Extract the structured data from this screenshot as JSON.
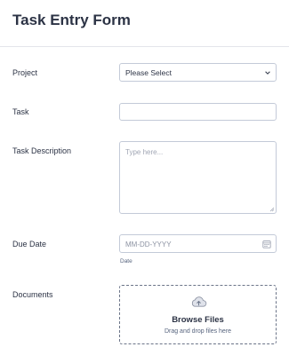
{
  "form": {
    "title": "Task Entry Form"
  },
  "fields": {
    "project": {
      "label": "Project",
      "selected": "Please Select"
    },
    "task": {
      "label": "Task",
      "value": ""
    },
    "description": {
      "label": "Task Description",
      "placeholder": "Type here..."
    },
    "due_date": {
      "label": "Due Date",
      "placeholder": "MM-DD-YYYY",
      "sublabel": "Date"
    },
    "documents": {
      "label": "Documents",
      "button_text": "Browse Files",
      "hint": "Drag and drop files here"
    }
  },
  "icons": {
    "select_chevron": "chevron-down-icon",
    "calendar": "calendar-icon",
    "upload": "cloud-upload-icon",
    "resize": "resize-handle-icon"
  },
  "colors": {
    "text": "#2c3345",
    "border": "#c3cad8",
    "placeholder": "#a0a6b4",
    "dashed_border": "#6b7488"
  }
}
